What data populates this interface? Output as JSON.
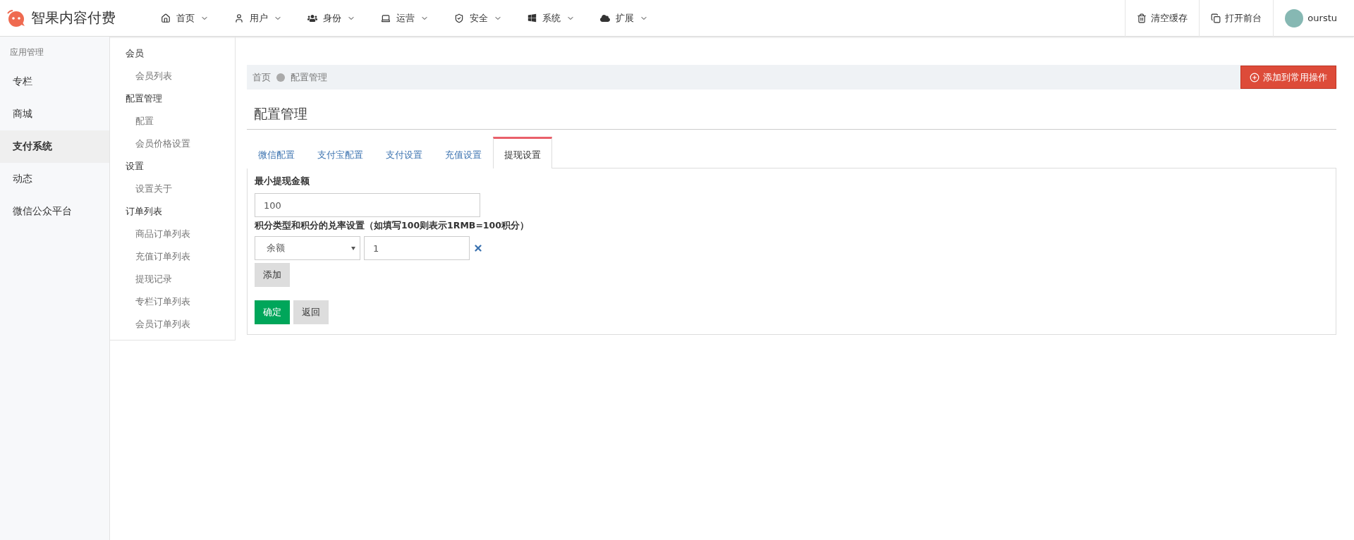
{
  "brand": {
    "name": "智果内容付费"
  },
  "nav": [
    {
      "label": "首页",
      "kind": "home"
    },
    {
      "label": "用户",
      "kind": "user"
    },
    {
      "label": "身份",
      "kind": "users"
    },
    {
      "label": "运营",
      "kind": "laptop"
    },
    {
      "label": "安全",
      "kind": "shield"
    },
    {
      "label": "系统",
      "kind": "windows"
    },
    {
      "label": "扩展",
      "kind": "cloud"
    }
  ],
  "top_actions": [
    {
      "label": "清空缓存",
      "kind": "trash"
    },
    {
      "label": "打开前台",
      "kind": "copy"
    }
  ],
  "user": {
    "name": "ourstu"
  },
  "sidebar": {
    "heading": "应用管理",
    "items": [
      {
        "label": "专栏",
        "selected": false
      },
      {
        "label": "商城",
        "selected": false
      },
      {
        "label": "支付系统",
        "selected": true
      },
      {
        "label": "动态",
        "selected": false
      },
      {
        "label": "微信公众平台",
        "selected": false
      }
    ]
  },
  "submenu": [
    {
      "label": "会员",
      "children": [
        {
          "label": "会员列表"
        }
      ]
    },
    {
      "label": "配置管理",
      "children": [
        {
          "label": "配置"
        },
        {
          "label": "会员价格设置"
        }
      ]
    },
    {
      "label": "设置",
      "children": [
        {
          "label": "设置关于"
        }
      ]
    },
    {
      "label": "订单列表",
      "children": [
        {
          "label": "商品订单列表"
        },
        {
          "label": "充值订单列表"
        },
        {
          "label": "提现记录"
        },
        {
          "label": "专栏订单列表"
        },
        {
          "label": "会员订单列表"
        }
      ]
    }
  ],
  "breadcrumb": [
    "首页",
    "配置管理"
  ],
  "add_button": "添加到常用操作",
  "page_title": "配置管理",
  "tabs": [
    {
      "label": "微信配置",
      "selected": false
    },
    {
      "label": "支付宝配置",
      "selected": false
    },
    {
      "label": "支付设置",
      "selected": false
    },
    {
      "label": "充值设置",
      "selected": false
    },
    {
      "label": "提现设置",
      "selected": true
    }
  ],
  "form": {
    "min_label": "最小提现金额",
    "min_value": "100",
    "rate_label": "积分类型和积分的兑率设置（如填写100则表示1RMB=100积分）",
    "rate_rows": [
      {
        "type": "余额",
        "value": "1"
      }
    ],
    "add": "添加",
    "submit": "确定",
    "back": "返回"
  }
}
